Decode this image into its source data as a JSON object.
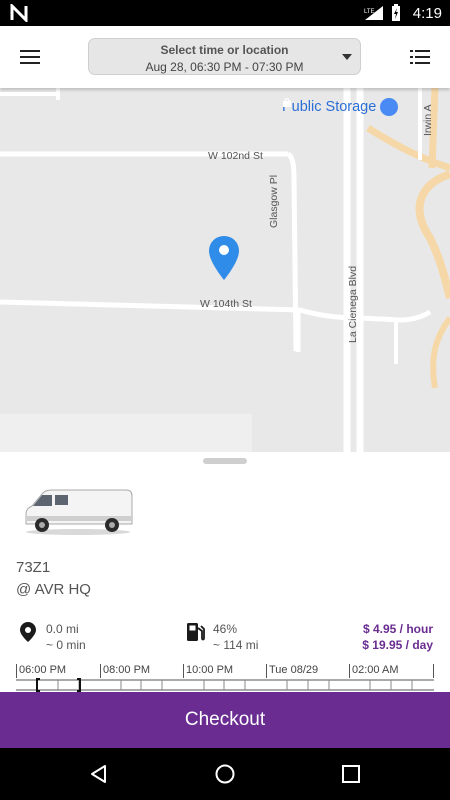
{
  "status_bar": {
    "time": "4:19",
    "network": "LTE",
    "icons": [
      "n-logo-icon",
      "signal-icon",
      "battery-charging-icon"
    ]
  },
  "header": {
    "selector_title": "Select time or location",
    "selector_subtitle": "Aug 28, 06:30 PM - 07:30 PM",
    "icons": [
      "hamburger-menu-icon",
      "list-icon",
      "dropdown-caret-icon"
    ]
  },
  "map": {
    "streets": [
      "W 102nd St",
      "W 104th St",
      "Glasgow Pl",
      "La Cienega Blvd",
      "Irwin A"
    ],
    "poi_label": "Public Storage",
    "marker_icon": "map-pin-icon",
    "colors": {
      "land": "#e8e8e8",
      "road": "#ffffff",
      "highway": "#f6d8a8",
      "marker": "#2f8ce8",
      "poi": "#2a6fd6"
    }
  },
  "vehicle": {
    "name": "73Z1",
    "location": "@ AVR HQ",
    "distance": "0.0 mi",
    "drive_time": "~ 0 min",
    "fuel_level": "46%",
    "range": "~ 114 mi",
    "price_hour": "$ 4.95 / hour",
    "price_day": "$ 19.95 / day",
    "icons": [
      "location-pin-icon",
      "fuel-pump-icon",
      "van-image"
    ]
  },
  "timeline": {
    "labels": [
      "06:00 PM",
      "08:00 PM",
      "10:00 PM",
      "Tue 08/29",
      "02:00 AM"
    ]
  },
  "checkout": {
    "label": "Checkout",
    "color": "#6a2c91"
  },
  "navigation": {
    "icons": [
      "back-icon",
      "home-icon",
      "recents-icon"
    ]
  }
}
